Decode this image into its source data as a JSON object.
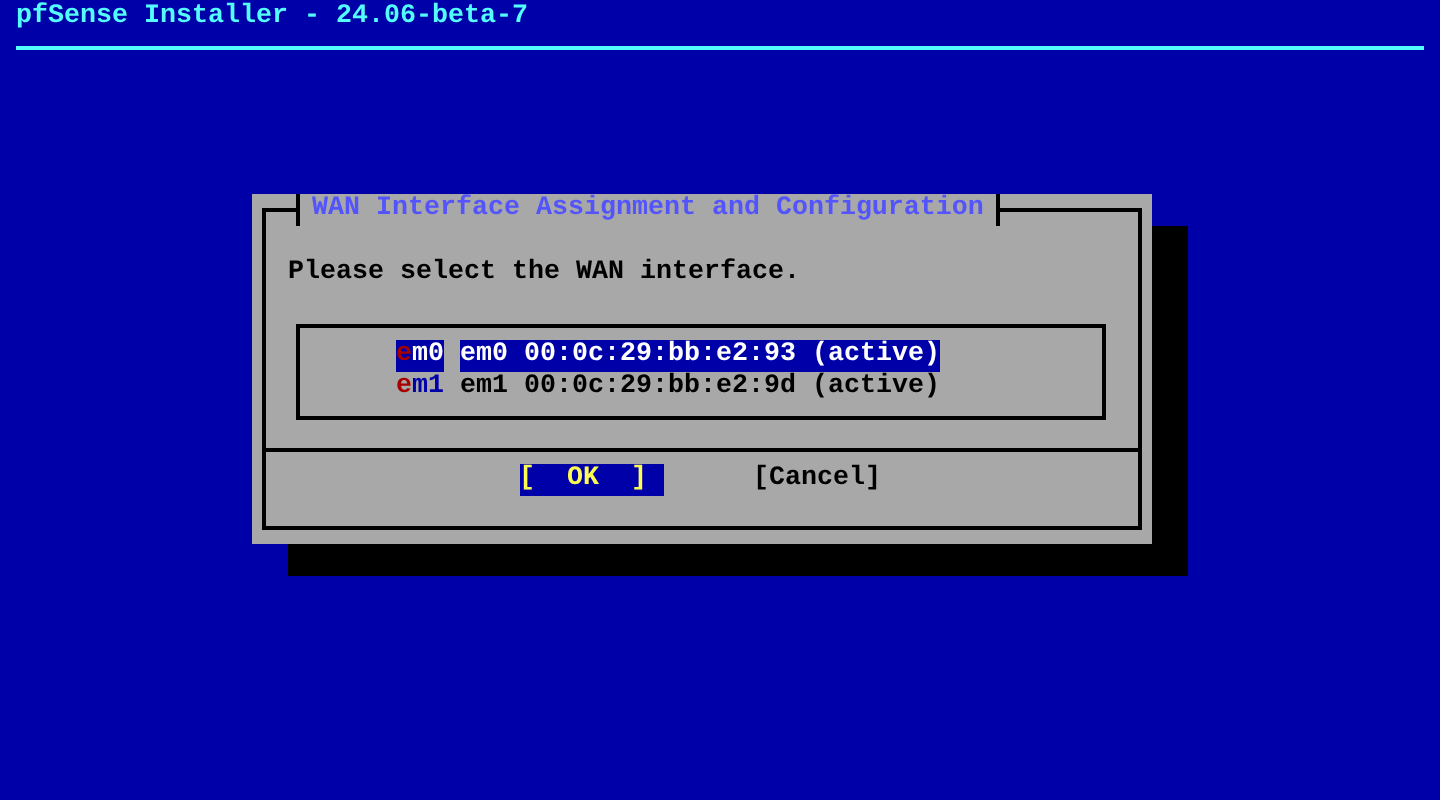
{
  "header": {
    "title": "pfSense Installer - 24.06-beta-7"
  },
  "dialog": {
    "title": "WAN Interface Assignment and Configuration",
    "message": "Please select the WAN interface.",
    "items": [
      {
        "tag": "em0",
        "description": "em0 00:0c:29:bb:e2:93 (active)",
        "selected": true
      },
      {
        "tag": "em1",
        "description": "em1 00:0c:29:bb:e2:9d (active)",
        "selected": false
      }
    ],
    "buttons": [
      {
        "label": "[  OK  ]",
        "selected": true
      },
      {
        "label": "[Cancel]",
        "selected": false
      }
    ]
  }
}
